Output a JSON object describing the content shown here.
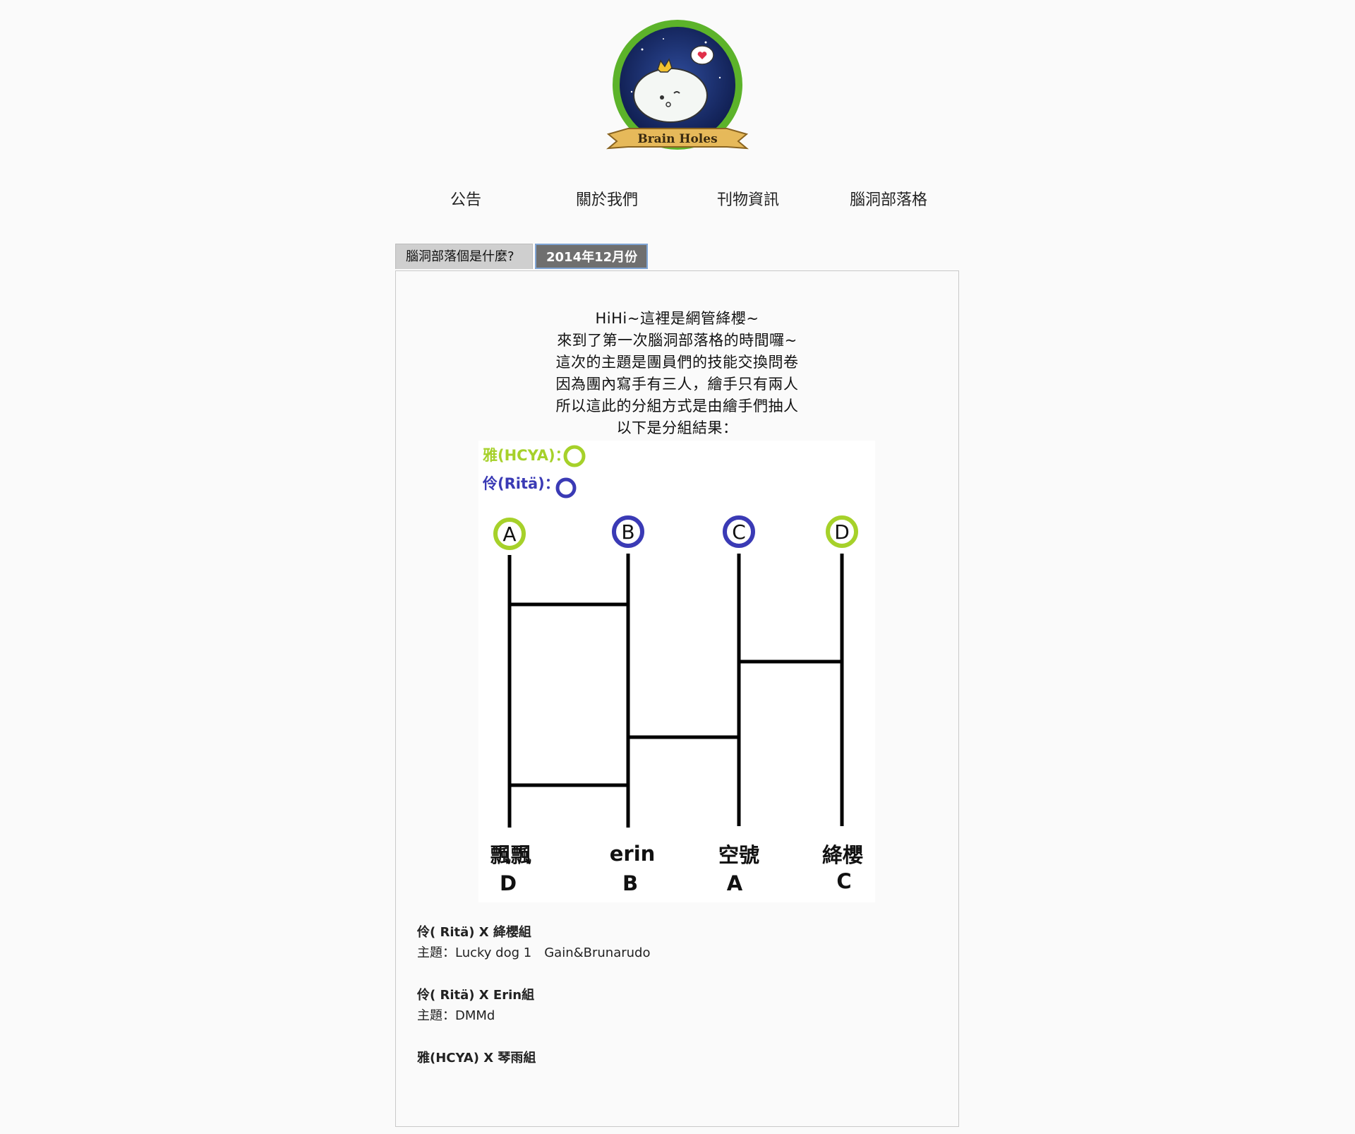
{
  "logo": {
    "text": "Brain Holes"
  },
  "nav": [
    {
      "label": "公告"
    },
    {
      "label": "關於我們"
    },
    {
      "label": "刊物資訊"
    },
    {
      "label": "腦洞部落格"
    }
  ],
  "tabs": [
    {
      "label": "腦洞部落個是什麼?",
      "active": false
    },
    {
      "label": "2014年12月份",
      "active": true
    }
  ],
  "intro_lines": [
    "HiHi~這裡是網管絳櫻~",
    "來到了第一次腦洞部落格的時間囉~",
    "這次的主題是團員們的技能交換問卷",
    "因為團內寫手有三人，繪手只有兩人",
    "所以這此的分組方式是由繪手們抽人",
    "以下是分組結果："
  ],
  "diagram": {
    "legend": [
      {
        "label": "雅(HCYA)：",
        "color": "#a6d12a"
      },
      {
        "label": "伶(Ritä)：",
        "color": "#3a3ab5"
      }
    ],
    "top_letters": [
      {
        "letter": "A",
        "color": "#a6d12a"
      },
      {
        "letter": "B",
        "color": "#3a3ab5"
      },
      {
        "letter": "C",
        "color": "#3a3ab5"
      },
      {
        "letter": "D",
        "color": "#a6d12a"
      }
    ],
    "names": [
      "飄飄",
      "erin",
      "空號",
      "絳櫻"
    ],
    "results": [
      "D",
      "B",
      "A",
      "C"
    ]
  },
  "groups": [
    {
      "title": "伶( Ritä) X 絳櫻組",
      "theme": "主題：Lucky dog 1　Gain&Brunarudo"
    },
    {
      "title": "伶( Ritä) X Erin組",
      "theme": "主題：DMMd"
    },
    {
      "title": "雅(HCYA) X 琴雨組",
      "theme": ""
    }
  ]
}
